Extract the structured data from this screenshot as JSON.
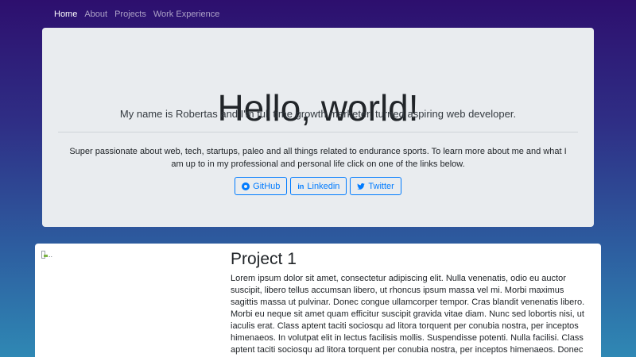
{
  "nav": {
    "items": [
      {
        "label": "Home",
        "active": true
      },
      {
        "label": "About",
        "active": false
      },
      {
        "label": "Projects",
        "active": false
      },
      {
        "label": "Work Experience",
        "active": false
      }
    ]
  },
  "hero": {
    "title": "Hello, world!",
    "lead": "My name is Robertas and I'm full time growth marketer, turned aspiring web developer.",
    "text": "Super passionate about web, tech, startups, paleo and all things related to endurance sports. To learn more about me and what I am up to in my professional and personal life click on one of the links below.",
    "buttons": [
      {
        "label": "GitHub",
        "icon": "github-icon"
      },
      {
        "label": "Linkedin",
        "icon": "linkedin-icon"
      },
      {
        "label": "Twitter",
        "icon": "twitter-icon"
      }
    ]
  },
  "project": {
    "image_alt": "...",
    "title": "Project 1",
    "text": "Lorem ipsum dolor sit amet, consectetur adipiscing elit. Nulla venenatis, odio eu auctor suscipit, libero tellus accumsan libero, ut rhoncus ipsum massa vel mi. Morbi maximus sagittis massa ut pulvinar. Donec congue ullamcorper tempor. Cras blandit venenatis libero. Morbi eu neque sit amet quam efficitur suscipit gravida vitae diam. Nunc sed lobortis nisi, ut iaculis erat. Class aptent taciti sociosqu ad litora torquent per conubia nostra, per inceptos himenaeos. In volutpat elit in lectus facilisis mollis. Suspendisse potenti. Nulla facilisi. Class aptent taciti sociosqu ad litora torquent per conubia nostra, per inceptos himenaeos. Donec volutpat molestie tristique. Maecenas eget ultricies urna. Vivamus pretium"
  },
  "colors": {
    "accent": "#007bff",
    "jumbotron_bg": "#e9ecef",
    "gradient_top": "#2d0f6e",
    "gradient_bottom": "#2f88b4"
  }
}
